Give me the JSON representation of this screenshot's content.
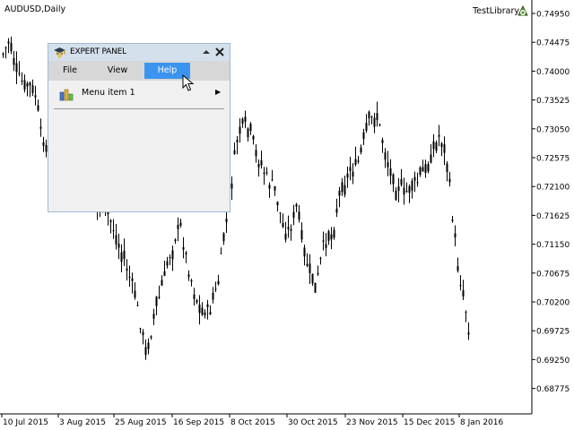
{
  "chart": {
    "symbol": "AUDUSD,Daily",
    "expert": "TestLibrary",
    "price_labels": [
      "0.74950",
      "0.74475",
      "0.74000",
      "0.73525",
      "0.73050",
      "0.72575",
      "0.72100",
      "0.71625",
      "0.71150",
      "0.70675",
      "0.70200",
      "0.69725",
      "0.69250",
      "0.68775"
    ],
    "date_labels": [
      "10 Jul 2015",
      "3 Aug 2015",
      "25 Aug 2015",
      "16 Sep 2015",
      "8 Oct 2015",
      "30 Oct 2015",
      "23 Nov 2015",
      "15 Dec 2015",
      "8 Jan 2016"
    ],
    "colors": {
      "background": "#ffffff",
      "bars": "#000000",
      "axis": "#000000"
    }
  },
  "panel": {
    "title": "EXPERT PANEL",
    "collapse_icon": "triangle-up-icon",
    "close_icon": "close-icon",
    "menus": [
      "File",
      "View",
      "Help"
    ],
    "active_menu": "Help",
    "context_items": [
      {
        "label": "Menu item 1",
        "icon": "bar-chart-icon",
        "submenu": true
      }
    ],
    "colors": {
      "caption": "#d4e0ec",
      "menubar": "#d7d7d7",
      "active": "#3b95f0",
      "body": "#f0f0f0"
    }
  }
}
